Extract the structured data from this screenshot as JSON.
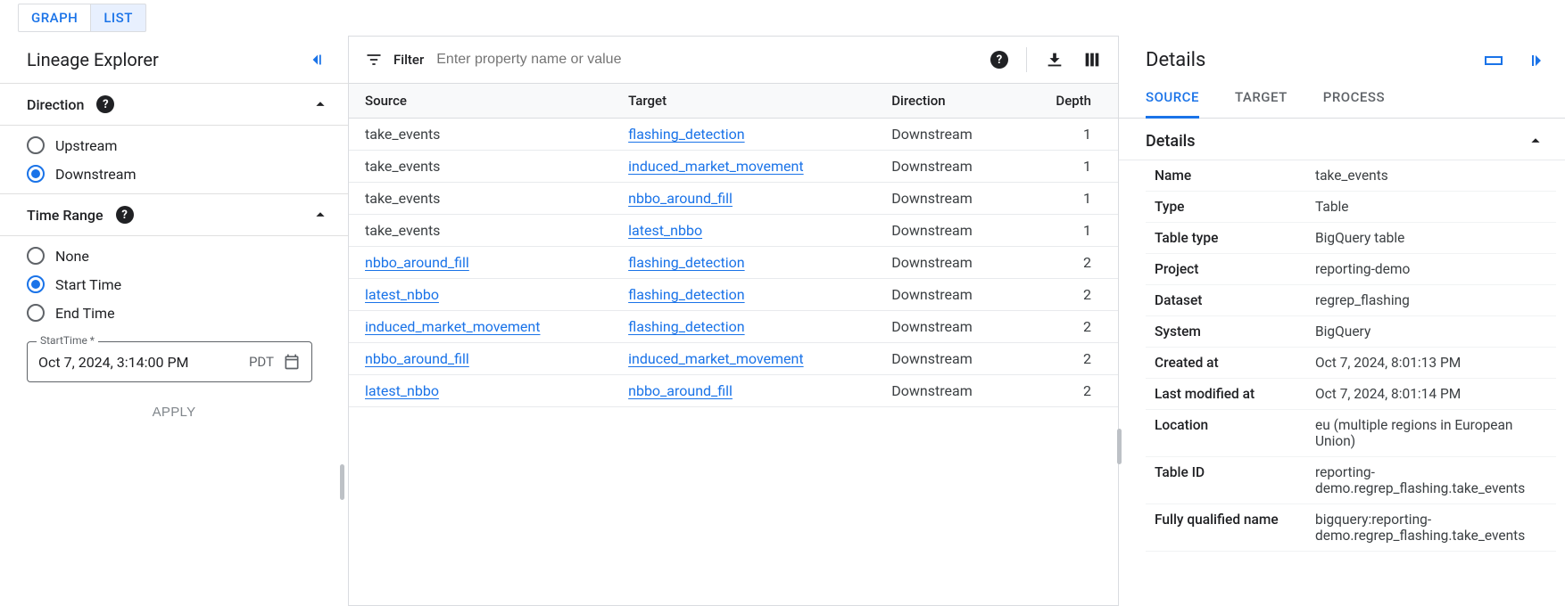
{
  "view_tabs": {
    "graph": "GRAPH",
    "list": "LIST"
  },
  "sidebar": {
    "title": "Lineage Explorer",
    "direction": {
      "heading": "Direction",
      "options": {
        "upstream": "Upstream",
        "downstream": "Downstream"
      },
      "selected": "downstream"
    },
    "time_range": {
      "heading": "Time Range",
      "options": {
        "none": "None",
        "start": "Start Time",
        "end": "End Time"
      },
      "selected": "start",
      "field_label": "StartTime *",
      "value": "Oct 7, 2024, 3:14:00 PM",
      "tz": "PDT"
    },
    "apply": "APPLY"
  },
  "filter": {
    "label": "Filter",
    "placeholder": "Enter property name or value"
  },
  "table": {
    "cols": {
      "source": "Source",
      "target": "Target",
      "direction": "Direction",
      "depth": "Depth"
    },
    "rows": [
      {
        "source": "take_events",
        "source_link": false,
        "target": "flashing_detection",
        "direction": "Downstream",
        "depth": "1"
      },
      {
        "source": "take_events",
        "source_link": false,
        "target": "induced_market_movement",
        "direction": "Downstream",
        "depth": "1"
      },
      {
        "source": "take_events",
        "source_link": false,
        "target": "nbbo_around_fill",
        "direction": "Downstream",
        "depth": "1"
      },
      {
        "source": "take_events",
        "source_link": false,
        "target": "latest_nbbo",
        "direction": "Downstream",
        "depth": "1"
      },
      {
        "source": "nbbo_around_fill",
        "source_link": true,
        "target": "flashing_detection",
        "direction": "Downstream",
        "depth": "2"
      },
      {
        "source": "latest_nbbo",
        "source_link": true,
        "target": "flashing_detection",
        "direction": "Downstream",
        "depth": "2"
      },
      {
        "source": "induced_market_movement",
        "source_link": true,
        "target": "flashing_detection",
        "direction": "Downstream",
        "depth": "2"
      },
      {
        "source": "nbbo_around_fill",
        "source_link": true,
        "target": "induced_market_movement",
        "direction": "Downstream",
        "depth": "2"
      },
      {
        "source": "latest_nbbo",
        "source_link": true,
        "target": "nbbo_around_fill",
        "direction": "Downstream",
        "depth": "2"
      }
    ]
  },
  "details": {
    "title": "Details",
    "tabs": {
      "source": "SOURCE",
      "target": "TARGET",
      "process": "PROCESS"
    },
    "subheader": "Details",
    "items": [
      {
        "k": "Name",
        "v": "take_events"
      },
      {
        "k": "Type",
        "v": "Table"
      },
      {
        "k": "Table type",
        "v": "BigQuery table"
      },
      {
        "k": "Project",
        "v": "reporting-demo"
      },
      {
        "k": "Dataset",
        "v": "regrep_flashing"
      },
      {
        "k": "System",
        "v": "BigQuery"
      },
      {
        "k": "Created at",
        "v": "Oct 7, 2024, 8:01:13 PM"
      },
      {
        "k": "Last modified at",
        "v": "Oct 7, 2024, 8:01:14 PM"
      },
      {
        "k": "Location",
        "v": "eu (multiple regions in European Union)"
      },
      {
        "k": "Table ID",
        "v": "reporting-demo.regrep_flashing.take_events"
      },
      {
        "k": "Fully qualified name",
        "v": "bigquery:reporting-demo.regrep_flashing.take_events"
      }
    ]
  }
}
